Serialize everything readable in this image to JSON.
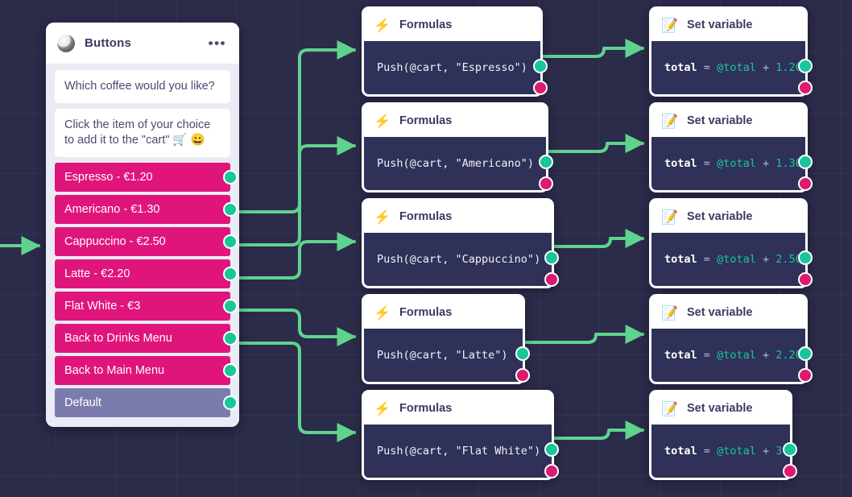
{
  "canvas": {
    "background_color": "#2b2b4a",
    "grid": true,
    "edge_color": "#5fd38d"
  },
  "colors": {
    "accent_pink": "#e0157c",
    "accent_green": "#16c79a",
    "port_pink": "#dc1b70",
    "node_body": "#2f3159",
    "default_button": "#7b7cab",
    "title_text": "#3a3a66"
  },
  "buttons_card": {
    "icon": "record-circle-icon",
    "title": "Buttons",
    "menu_label": "•••",
    "messages": [
      "Which coffee would you like?",
      "Click the item of your choice to add it to the \"cart\" 🛒 😀"
    ],
    "buttons": [
      {
        "label": "Espresso - €1.20",
        "style": "pink"
      },
      {
        "label": "Americano - €1.30",
        "style": "pink"
      },
      {
        "label": "Cappuccino - €2.50",
        "style": "pink"
      },
      {
        "label": "Latte - €2.20",
        "style": "pink"
      },
      {
        "label": "Flat White - €3",
        "style": "pink"
      },
      {
        "label": "Back to Drinks Menu",
        "style": "pink"
      },
      {
        "label": "Back to Main Menu",
        "style": "pink"
      },
      {
        "label": "Default",
        "style": "default"
      }
    ]
  },
  "formula_nodes": [
    {
      "icon": "⚡",
      "icon_name": "lightning-icon",
      "title": "Formulas",
      "code": "Push(@cart, \"Espresso\")"
    },
    {
      "icon": "⚡",
      "icon_name": "lightning-icon",
      "title": "Formulas",
      "code": "Push(@cart, \"Americano\")"
    },
    {
      "icon": "⚡",
      "icon_name": "lightning-icon",
      "title": "Formulas",
      "code": "Push(@cart, \"Cappuccino\")"
    },
    {
      "icon": "⚡",
      "icon_name": "lightning-icon",
      "title": "Formulas",
      "code": "Push(@cart, \"Latte\")"
    },
    {
      "icon": "⚡",
      "icon_name": "lightning-icon",
      "title": "Formulas",
      "code": "Push(@cart, \"Flat White\")"
    }
  ],
  "setvar_nodes": [
    {
      "icon": "📝",
      "icon_name": "memo-icon",
      "title": "Set variable",
      "variable": "total",
      "assign": "=",
      "reference": "@total",
      "operator": "+",
      "value": "1.20"
    },
    {
      "icon": "📝",
      "icon_name": "memo-icon",
      "title": "Set variable",
      "variable": "total",
      "assign": "=",
      "reference": "@total",
      "operator": "+",
      "value": "1.30"
    },
    {
      "icon": "📝",
      "icon_name": "memo-icon",
      "title": "Set variable",
      "variable": "total",
      "assign": "=",
      "reference": "@total",
      "operator": "+",
      "value": "2.50"
    },
    {
      "icon": "📝",
      "icon_name": "memo-icon",
      "title": "Set variable",
      "variable": "total",
      "assign": "=",
      "reference": "@total",
      "operator": "+",
      "value": "2.20"
    },
    {
      "icon": "📝",
      "icon_name": "memo-icon",
      "title": "Set variable",
      "variable": "total",
      "assign": "=",
      "reference": "@total",
      "operator": "+",
      "value": "3"
    }
  ]
}
